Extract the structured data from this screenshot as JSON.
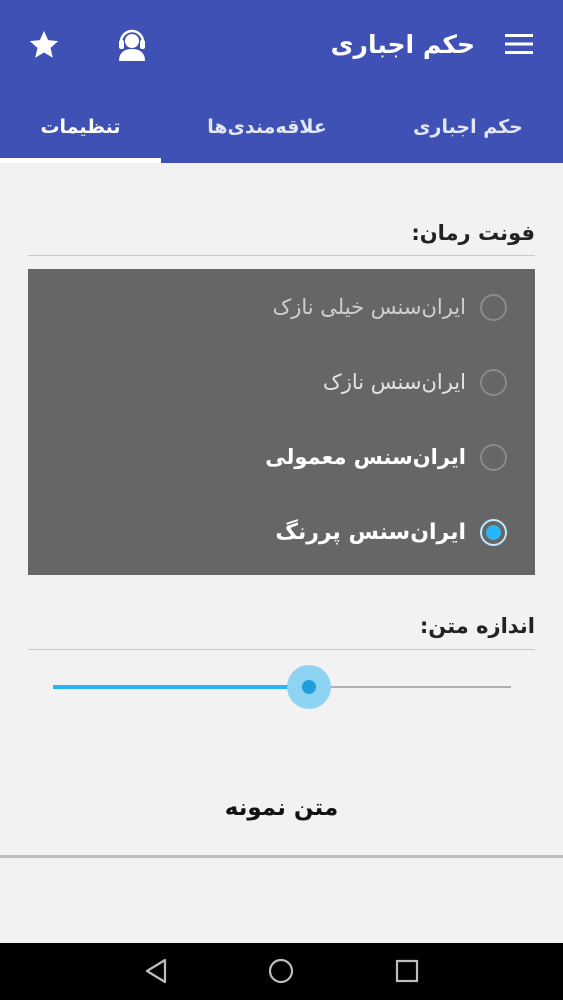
{
  "toolbar": {
    "title": "حکم اجباری",
    "menu_icon": "hamburger-menu-icon",
    "support_icon": "headset-support-icon",
    "star_icon": "star-icon"
  },
  "tabs": [
    {
      "label": "حکم اجباری",
      "active": false
    },
    {
      "label": "علاقه‌مندی‌ها",
      "active": false
    },
    {
      "label": "تنظیمات",
      "active": true
    }
  ],
  "font_section": {
    "label": "فونت رمان:",
    "options": [
      {
        "label": "ایران‌سنس خیلی نازک",
        "checked": false
      },
      {
        "label": "ایران‌سنس نازک",
        "checked": false
      },
      {
        "label": "ایران‌سنس معمولی",
        "checked": false
      },
      {
        "label": "ایران‌سنس پررنگ",
        "checked": true
      }
    ]
  },
  "size_section": {
    "label": "اندازه متن:",
    "slider_fraction": 0.56
  },
  "sample_text": "متن نمونه",
  "colors": {
    "appbar": "#3f51b5",
    "accent": "#29b6f6",
    "panel": "#666666"
  },
  "nav": {
    "back_icon": "back-triangle-icon",
    "home_icon": "home-circle-icon",
    "recents_icon": "recents-square-icon"
  }
}
